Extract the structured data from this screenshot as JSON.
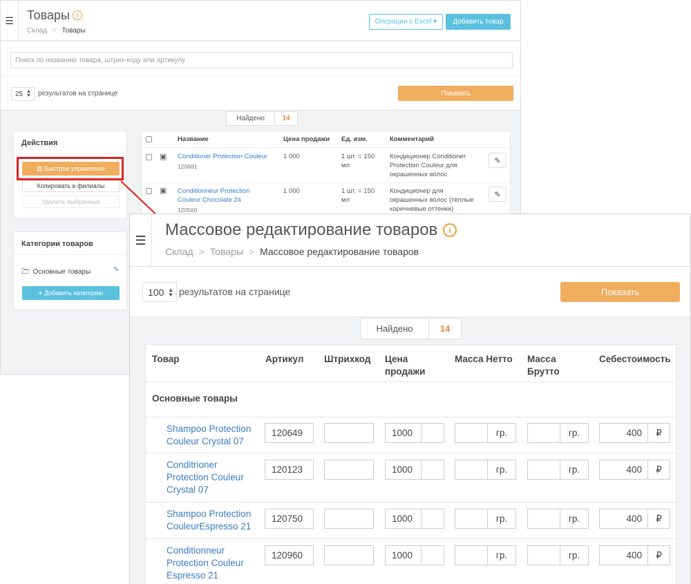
{
  "back": {
    "title": "Товары",
    "info_glyph": "i",
    "crumb_1": "Склад",
    "crumb_sep": ">",
    "crumb_2": "Товары",
    "btn_excel": "Операции с Excel ▾",
    "btn_add": "Добавить товар",
    "search_placeholder": "Поиск по названию товара, штрих-коду или артикулу",
    "per_page_value": "25",
    "per_page_label": "результатов на странице",
    "btn_show": "Показать",
    "found_label": "Найдено",
    "found_count": "14",
    "actions": {
      "heading": "Действия",
      "quick": "Быстрое управление",
      "copy": "Копировать в филиалы",
      "delete": "Удалить выбранных"
    },
    "categories": {
      "heading": "Категории товаров",
      "item": "Основные товары",
      "add": "Добавить категорию"
    },
    "table": {
      "headers": [
        "Название",
        "Цена продажи",
        "Ед. изм.",
        "Комментарий"
      ],
      "rows": [
        {
          "name_1": "Conditioner Protection Couleur",
          "name_2": "",
          "sku": "120881",
          "price": "1 000",
          "unit_1": "1 шт. = 150",
          "unit_2": "мл",
          "comment_1": "Кондиционер Conditioner",
          "comment_2": "Protection Couleur для",
          "comment_3": "окрашенных волос"
        },
        {
          "name_1": "Conditionneur Protection",
          "name_2": "Couleur Chocolate 24",
          "sku": "120560",
          "price": "1 000",
          "unit_1": "1 шт. = 150",
          "unit_2": "мл",
          "comment_1": "Кондиционер для",
          "comment_2": "окрашенных волос (тёплые",
          "comment_3": "коричневые оттенки)"
        }
      ]
    }
  },
  "front": {
    "title": "Массовое редактирование товаров",
    "info_glyph": "i",
    "crumb_1": "Склад",
    "crumb_sep": ">",
    "crumb_2": "Товары",
    "crumb_3": "Массовое редактирование товаров",
    "per_page_value": "100",
    "per_page_label": "результатов на странице",
    "btn_show": "Показать",
    "found_label": "Найдено",
    "found_count": "14",
    "table": {
      "h_product": "Товар",
      "h_sku": "Артикул",
      "h_barcode": "Штрихкод",
      "h_price_1": "Цена",
      "h_price_2": "продажи",
      "h_net": "Масса Нетто",
      "h_gross_1": "Масса",
      "h_gross_2": "Брутто",
      "h_cost": "Себестоимость",
      "group": "Основные товары",
      "unit": "гр.",
      "currency": "₽",
      "rows": [
        {
          "name_1": "Shampoo Protection",
          "name_2": "Couleur Crystal 07",
          "name_3": "",
          "sku": "120649",
          "barcode": "",
          "price": "1000",
          "net": "",
          "gross": "",
          "cost": "400"
        },
        {
          "name_1": "Conditrioner",
          "name_2": "Protection Couleur",
          "name_3": "Crystal 07",
          "sku": "120123",
          "barcode": "",
          "price": "1000",
          "net": "",
          "gross": "",
          "cost": "400"
        },
        {
          "name_1": "Shampoo Protection",
          "name_2": "CouleurEspresso 21",
          "name_3": "",
          "sku": "120750",
          "barcode": "",
          "price": "1000",
          "net": "",
          "gross": "",
          "cost": "400"
        },
        {
          "name_1": "Conditionneur",
          "name_2": "Protection Couleur",
          "name_3": "Espresso 21",
          "sku": "120960",
          "barcode": "",
          "price": "1000",
          "net": "",
          "gross": "",
          "cost": "400"
        }
      ]
    }
  },
  "colors": {
    "accent_orange": "#f0ad5e",
    "accent_blue": "#5bc0de",
    "link_blue": "#3a7cc1",
    "highlight_red": "#e0201c"
  }
}
